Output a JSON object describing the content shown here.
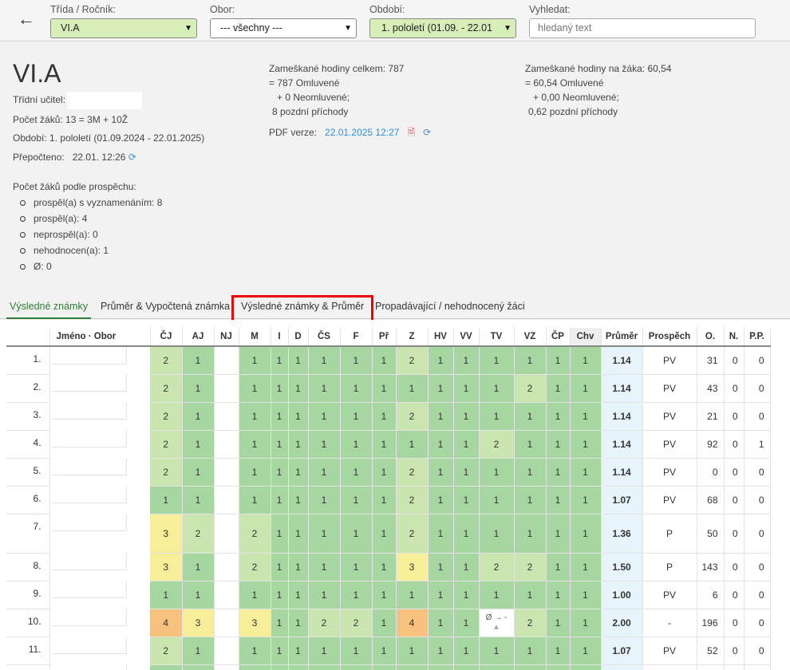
{
  "toolbar": {
    "class_label": "Třída / Ročník:",
    "class_value": "VI.A",
    "field_label": "Obor:",
    "field_value": "--- všechny ---",
    "period_label": "Období:",
    "period_value": "1. pololetí (01.09. - 22.01",
    "search_label": "Vyhledat:",
    "search_placeholder": "hledaný text"
  },
  "summary": {
    "title": "VI.A",
    "teacher_label": "Třídní učitel:",
    "students_label": "Počet žáků:",
    "students_value": "13 = 3M + 10Ž",
    "period_label": "Období:",
    "period_value": "1. pololetí (01.09.2024 - 22.01.2025)",
    "recalc_label": "Přepočteno:",
    "recalc_value": "22.01. 12:26",
    "absence_total_label": "Zameškané hodiny celkem:",
    "absence_total_value": "787",
    "absence_total_l2": "= 787 Omluvené",
    "absence_total_l3": "+ 0 Neomluvené;",
    "absence_total_l4": "8 pozdní příchody",
    "pdf_label": "PDF verze:",
    "pdf_value": "22.01.2025 12:27",
    "absence_per_label": "Zameškané hodiny na žáka:",
    "absence_per_value": "60,54",
    "absence_per_l2": "= 60,54 Omluvené",
    "absence_per_l3": "+ 0,00 Neomluvené;",
    "absence_per_l4": "0,62 pozdní příchody",
    "perf_heading": "Počet žáků podle prospěchu:",
    "perf_items": [
      "prospěl(a) s vyznamenáním: 8",
      "prospěl(a): 4",
      "neprospěl(a): 0",
      "nehodnocen(a): 1",
      "Ø: 0"
    ]
  },
  "tabs": [
    "Výsledné známky",
    "Průměr & Vypočtená známka",
    "Výsledné známky & Průměr",
    "Propadávající / nehodnocený žáci"
  ],
  "table": {
    "headers": [
      "",
      "Jméno · Obor",
      "ČJ",
      "AJ",
      "NJ",
      "M",
      "I",
      "D",
      "ČS",
      "F",
      "Př",
      "Z",
      "HV",
      "VV",
      "TV",
      "VZ",
      "ČP",
      "Chv",
      "Průměr",
      "Prospěch",
      "O.",
      "N.",
      "P.P."
    ],
    "rows": [
      {
        "n": "1.",
        "g": [
          "2",
          "1",
          "",
          "1",
          "1",
          "1",
          "1",
          "1",
          "1",
          "2",
          "1",
          "1",
          "1",
          "1",
          "1",
          "1"
        ],
        "avg": "1.14",
        "pr": "PV",
        "o": "31",
        "nn": "0",
        "pp": "0"
      },
      {
        "n": "2.",
        "g": [
          "2",
          "1",
          "",
          "1",
          "1",
          "1",
          "1",
          "1",
          "1",
          "1",
          "1",
          "1",
          "1",
          "2",
          "1",
          "1"
        ],
        "avg": "1.14",
        "pr": "PV",
        "o": "43",
        "nn": "0",
        "pp": "0"
      },
      {
        "n": "3.",
        "g": [
          "2",
          "1",
          "",
          "1",
          "1",
          "1",
          "1",
          "1",
          "1",
          "2",
          "1",
          "1",
          "1",
          "1",
          "1",
          "1"
        ],
        "avg": "1.14",
        "pr": "PV",
        "o": "21",
        "nn": "0",
        "pp": "0"
      },
      {
        "n": "4.",
        "g": [
          "2",
          "1",
          "",
          "1",
          "1",
          "1",
          "1",
          "1",
          "1",
          "1",
          "1",
          "1",
          "2",
          "1",
          "1",
          "1"
        ],
        "avg": "1.14",
        "pr": "PV",
        "o": "92",
        "nn": "0",
        "pp": "1"
      },
      {
        "n": "5.",
        "g": [
          "2",
          "1",
          "",
          "1",
          "1",
          "1",
          "1",
          "1",
          "1",
          "2",
          "1",
          "1",
          "1",
          "1",
          "1",
          "1"
        ],
        "avg": "1.14",
        "pr": "PV",
        "o": "0",
        "nn": "0",
        "pp": "0"
      },
      {
        "n": "6.",
        "g": [
          "1",
          "1",
          "",
          "1",
          "1",
          "1",
          "1",
          "1",
          "1",
          "2",
          "1",
          "1",
          "1",
          "1",
          "1",
          "1"
        ],
        "avg": "1.07",
        "pr": "PV",
        "o": "68",
        "nn": "0",
        "pp": "0"
      },
      {
        "n": "7.",
        "g": [
          "3",
          "2",
          "",
          "2",
          "1",
          "1",
          "1",
          "1",
          "1",
          "2",
          "1",
          "1",
          "1",
          "1",
          "1",
          "1"
        ],
        "avg": "1.36",
        "pr": "P",
        "o": "50",
        "nn": "0",
        "pp": "0"
      },
      {
        "n": "8.",
        "g": [
          "3",
          "1",
          "",
          "2",
          "1",
          "1",
          "1",
          "1",
          "1",
          "3",
          "1",
          "1",
          "2",
          "2",
          "1",
          "1"
        ],
        "avg": "1.50",
        "pr": "P",
        "o": "143",
        "nn": "0",
        "pp": "0"
      },
      {
        "n": "9.",
        "g": [
          "1",
          "1",
          "",
          "1",
          "1",
          "1",
          "1",
          "1",
          "1",
          "1",
          "1",
          "1",
          "1",
          "1",
          "1",
          "1"
        ],
        "avg": "1.00",
        "pr": "PV",
        "o": "6",
        "nn": "0",
        "pp": "0"
      },
      {
        "n": "10.",
        "g": [
          "4",
          "3",
          "",
          "3",
          "1",
          "1",
          "2",
          "2",
          "1",
          "4",
          "1",
          "1",
          "Ø → -",
          "2",
          "1",
          "1"
        ],
        "avg": "2.00",
        "pr": "-",
        "o": "196",
        "nn": "0",
        "pp": "0"
      },
      {
        "n": "11.",
        "g": [
          "2",
          "1",
          "",
          "1",
          "1",
          "1",
          "1",
          "1",
          "1",
          "1",
          "1",
          "1",
          "1",
          "1",
          "1",
          "1"
        ],
        "avg": "1.07",
        "pr": "PV",
        "o": "52",
        "nn": "0",
        "pp": "0"
      },
      {
        "n": "",
        "g": [
          "",
          "",
          "",
          "",
          "",
          "",
          "",
          "",
          "",
          "",
          "",
          "",
          "",
          "",
          "",
          ""
        ],
        "avg": "",
        "pr": "",
        "o": "",
        "nn": "",
        "pp": ""
      }
    ]
  }
}
